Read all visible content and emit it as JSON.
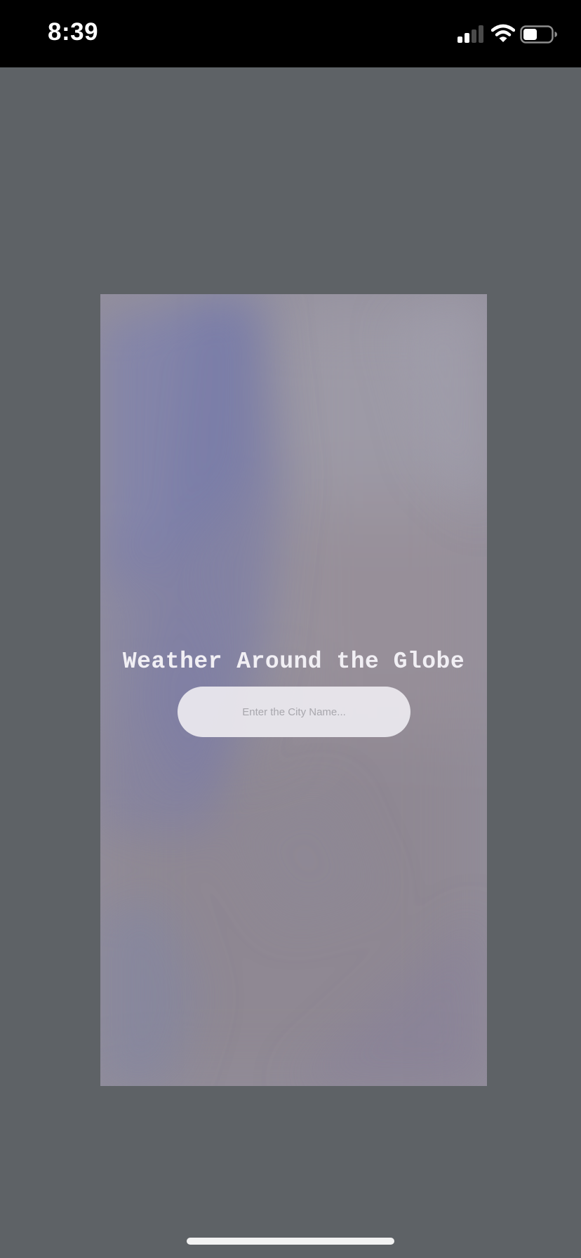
{
  "status_bar": {
    "time": "8:39",
    "icons": [
      "signal-icon",
      "wifi-icon",
      "battery-icon"
    ]
  },
  "app": {
    "title": "Weather Around the Globe",
    "search": {
      "placeholder": "Enter the City Name...",
      "value": ""
    }
  },
  "colors": {
    "page_background": "#5e6266",
    "status_bar": "#000000",
    "card_base": "#928f9c",
    "title_text": "#f1eff4",
    "input_background": "#eceaef"
  }
}
